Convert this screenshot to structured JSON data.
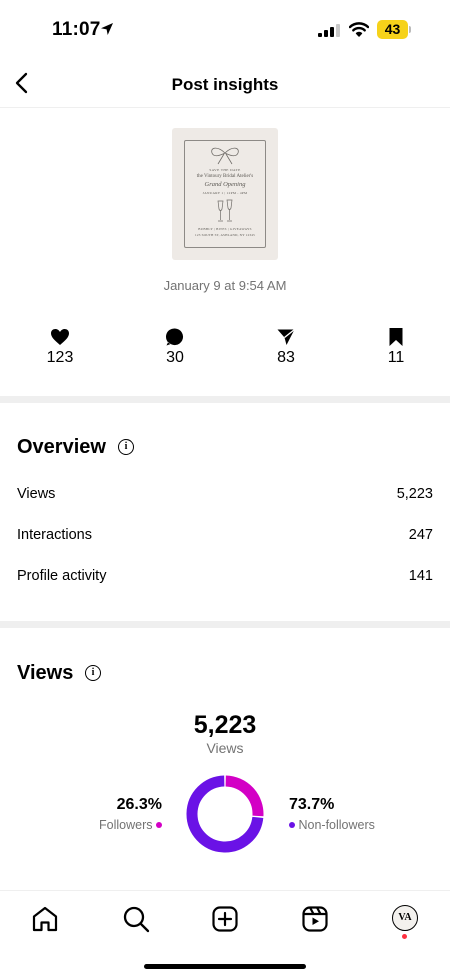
{
  "status_bar": {
    "time": "11:07",
    "battery": "43",
    "battery_color": "#f6d21a"
  },
  "header": {
    "title": "Post insights"
  },
  "post": {
    "thumbnail_lines": [
      "SAVE THE DATE",
      "the Vintoury Bridal Atelier's",
      "Grand Opening",
      "JANUARY 1 | 12PM - 4PM",
      "BUBBLY | BITES | GIVEAWAYS",
      "123 SOUTH ST, ASHLAND, NY 12345"
    ],
    "date": "January 9 at 9:54 AM"
  },
  "engagement": {
    "likes": "123",
    "comments": "30",
    "shares": "83",
    "saves": "11"
  },
  "overview": {
    "title": "Overview",
    "rows": [
      {
        "label": "Views",
        "value": "5,223"
      },
      {
        "label": "Interactions",
        "value": "247"
      },
      {
        "label": "Profile activity",
        "value": "141"
      }
    ]
  },
  "views": {
    "title": "Views",
    "total": "5,223",
    "total_label": "Views",
    "followers_pct": "26.3%",
    "followers_label": "Followers",
    "nonfollowers_pct": "73.7%",
    "nonfollowers_label": "Non-followers"
  },
  "chart_data": {
    "type": "pie",
    "categories": [
      "Followers",
      "Non-followers"
    ],
    "values": [
      26.3,
      73.7
    ],
    "colors": [
      "#d300c5",
      "#6a12e6"
    ]
  },
  "tab_bar": {
    "items": [
      "home-icon",
      "search-icon",
      "create-icon",
      "reels-icon",
      "profile-avatar"
    ],
    "avatar_initials": "VA"
  }
}
